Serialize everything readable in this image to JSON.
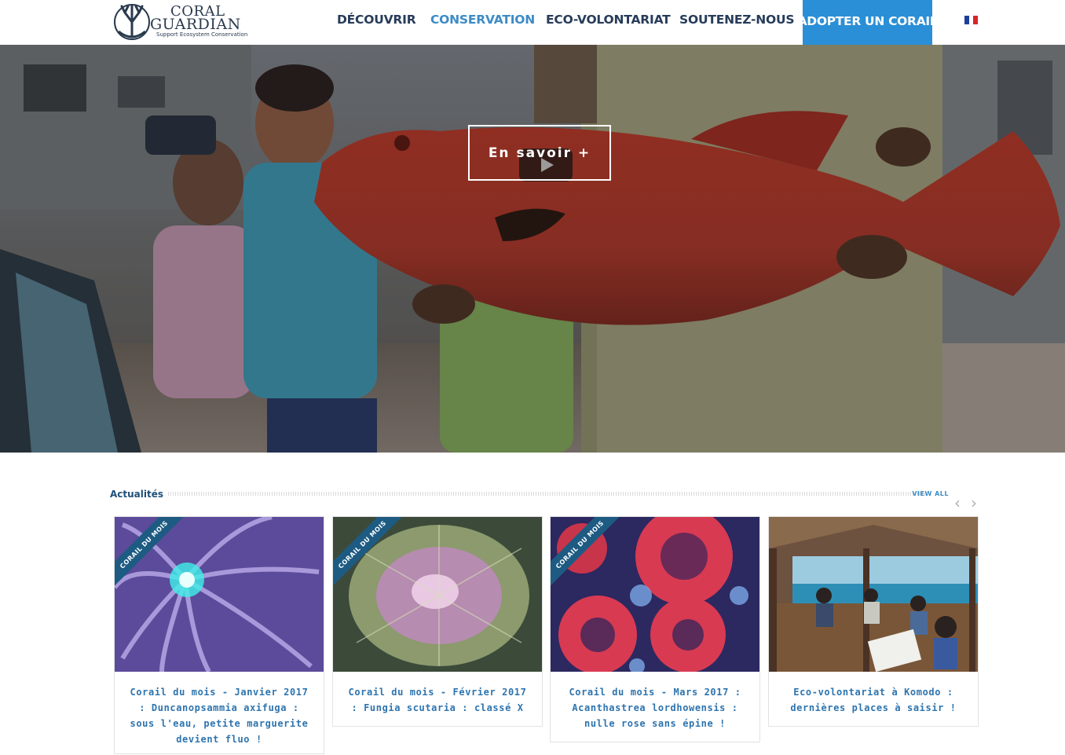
{
  "logo": {
    "line1": "CORAL",
    "line2": "GUARDIAN",
    "tagline": "Support Ecosystem Conservation"
  },
  "nav": {
    "items": [
      {
        "label": "DÉCOUVRIR",
        "active": false
      },
      {
        "label": "CONSERVATION",
        "active": true
      },
      {
        "label": "ECO-VOLONTARIAT",
        "active": false
      },
      {
        "label": "SOUTENEZ-NOUS",
        "active": false
      }
    ],
    "cta_label": "ADOPTER UN CORAIL",
    "language_icon": "french-flag-icon"
  },
  "hero": {
    "button_label": "En savoir +",
    "play_icon": "play-icon"
  },
  "news": {
    "title": "Actualités",
    "view_all": "VIEW ALL",
    "prev_icon": "chevron-left-icon",
    "next_icon": "chevron-right-icon",
    "cards": [
      {
        "ribbon": "CORAIL DU MOIS",
        "title": "Corail du mois - Janvier 2017 : Duncanopsammia axifuga : sous l'eau, petite marguerite devient fluo !"
      },
      {
        "ribbon": "CORAIL DU MOIS",
        "title": "Corail du mois - Février 2017 : Fungia scutaria : classé X"
      },
      {
        "ribbon": "CORAIL DU MOIS",
        "title": "Corail du mois - Mars 2017 : Acanthastrea lordhowensis : nulle rose sans épine !"
      },
      {
        "ribbon": "",
        "title": "Eco-volontariat à Komodo : dernières places à saisir !"
      }
    ]
  },
  "colors": {
    "nav_text": "#273c5a",
    "nav_active": "#3d8cc6",
    "cta_bg": "#2a8fd6",
    "card_title": "#2e74ae",
    "ribbon_bg": "#1d5b83"
  }
}
